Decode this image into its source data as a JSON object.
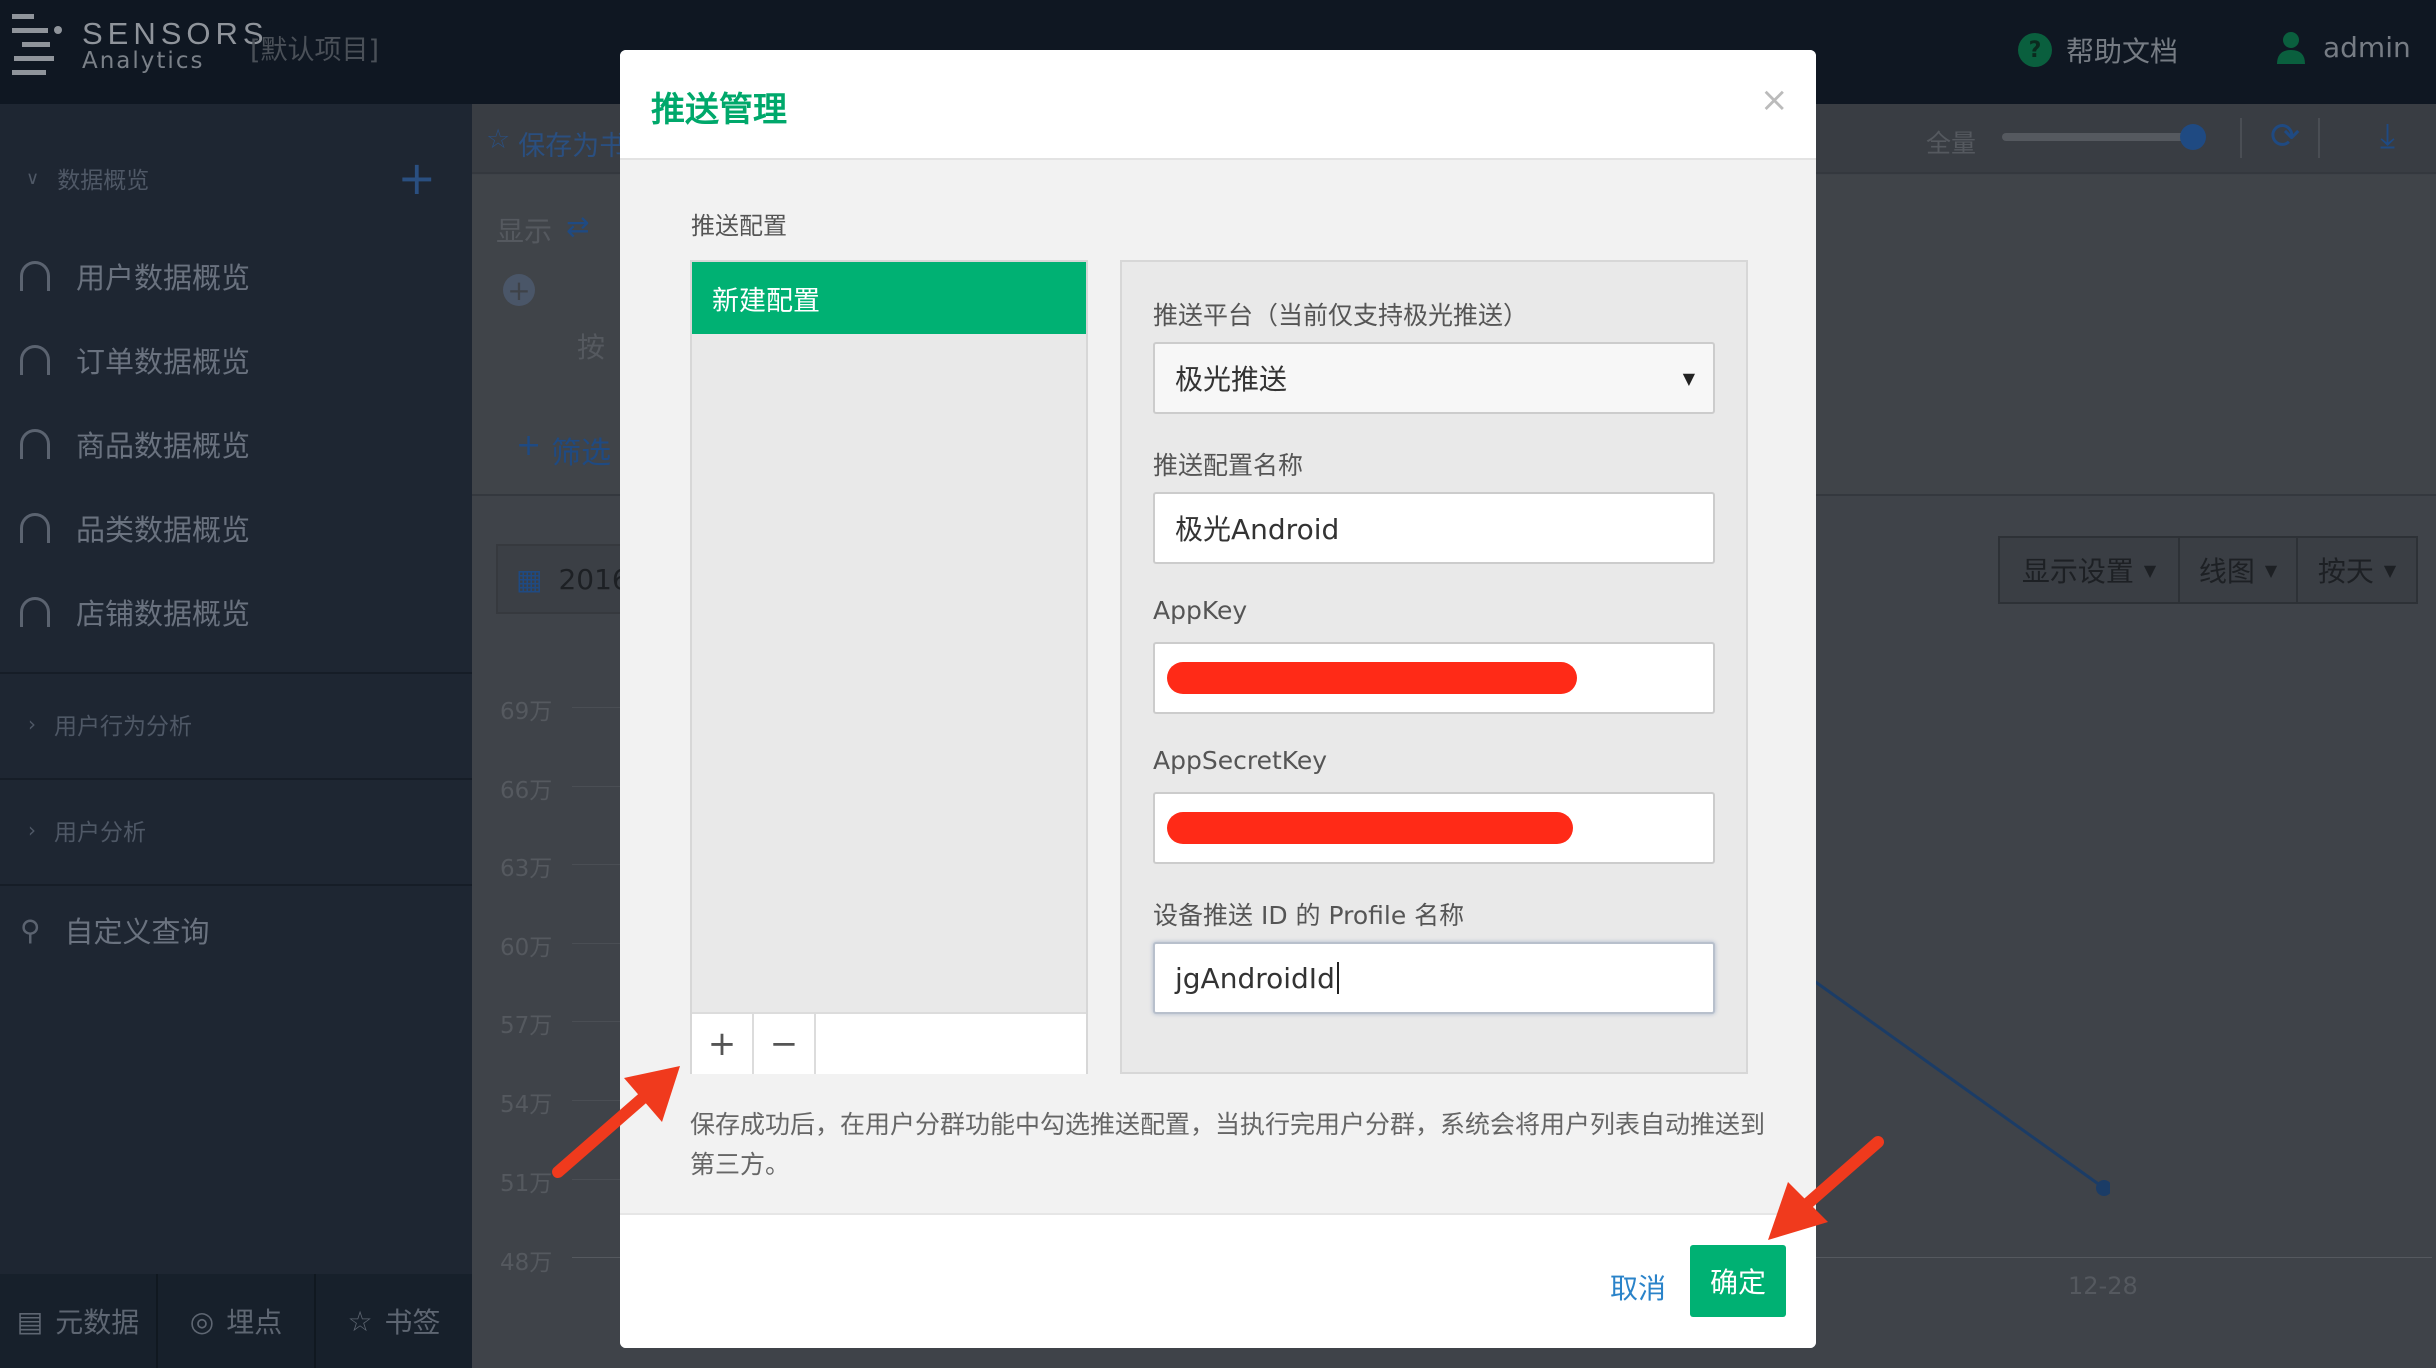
{
  "header": {
    "logo_line1": "SENSORS",
    "logo_line2": "Analytics",
    "project": "[默认项目]",
    "help": "帮助文档",
    "user": "admin"
  },
  "sidebar": {
    "section_overview": "数据概览",
    "items": [
      {
        "label": "用户数据概览"
      },
      {
        "label": "订单数据概览"
      },
      {
        "label": "商品数据概览"
      },
      {
        "label": "品类数据概览"
      },
      {
        "label": "店铺数据概览"
      }
    ],
    "section_behavior": "用户行为分析",
    "section_user": "用户分析",
    "custom_query": "自定义查询",
    "bottom": [
      "元数据",
      "埋点",
      "书签"
    ]
  },
  "main": {
    "save_as": "保存为书签",
    "full": "全量",
    "display": "显示",
    "by": "按",
    "filter": "筛选",
    "date": "2016",
    "display_settings": "显示设置",
    "line_chart": "线图",
    "by_day": "按天",
    "y_ticks": [
      "69万",
      "66万",
      "63万",
      "60万",
      "57万",
      "54万",
      "51万",
      "48万"
    ],
    "x_tick": "12-28"
  },
  "modal": {
    "title": "推送管理",
    "close": "×",
    "subtitle": "推送配置",
    "list_selected": "新建配置",
    "add": "+",
    "remove": "−",
    "platform_label": "推送平台（当前仅支持极光推送）",
    "platform_value": "极光推送",
    "name_label": "推送配置名称",
    "name_value": "极光Android",
    "appkey_label": "AppKey",
    "appsecret_label": "AppSecretKey",
    "profile_label": "设备推送 ID 的 Profile 名称",
    "profile_value": "jgAndroidId",
    "note": "保存成功后，在用户分群功能中勾选推送配置，当执行完用户分群，系统会将用户列表自动推送到第三方。",
    "cancel": "取消",
    "ok": "确定"
  },
  "colors": {
    "accent": "#00b173",
    "title": "#00a86b",
    "link": "#2a83c9",
    "annotation_arrow": "#f03a1d",
    "redaction": "#ff2a17"
  }
}
